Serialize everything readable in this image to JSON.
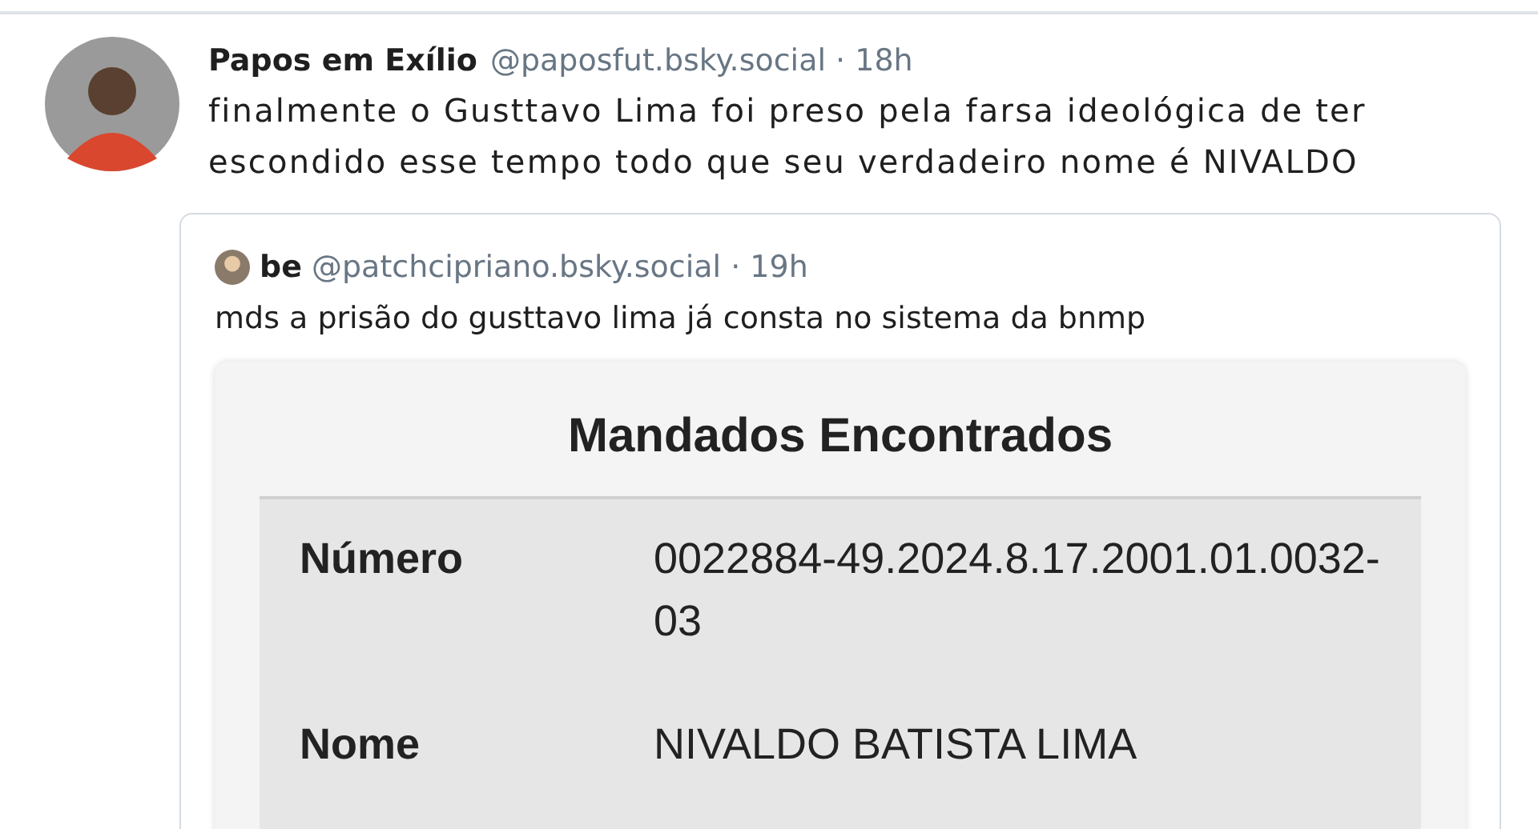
{
  "post": {
    "author": "Papos em Exílio",
    "handle": "@paposfut.bsky.social · 18h",
    "text": "finalmente o Gusttavo Lima foi preso pela farsa ideológica de ter escondido esse tempo todo que seu verdadeiro nome é NIVALDO"
  },
  "quote": {
    "author": "be",
    "handle": "@patchcipriano.bsky.social · 19h",
    "text": "mds a prisão do gusttavo lima já consta no sistema da bnmp",
    "image": {
      "title": "Mandados Encontrados",
      "fields": [
        {
          "label": "Número",
          "value": "0022884-49.2024.8.17.2001.01.0032-03"
        },
        {
          "label": "Nome",
          "value": "NIVALDO BATISTA LIMA"
        }
      ]
    }
  }
}
